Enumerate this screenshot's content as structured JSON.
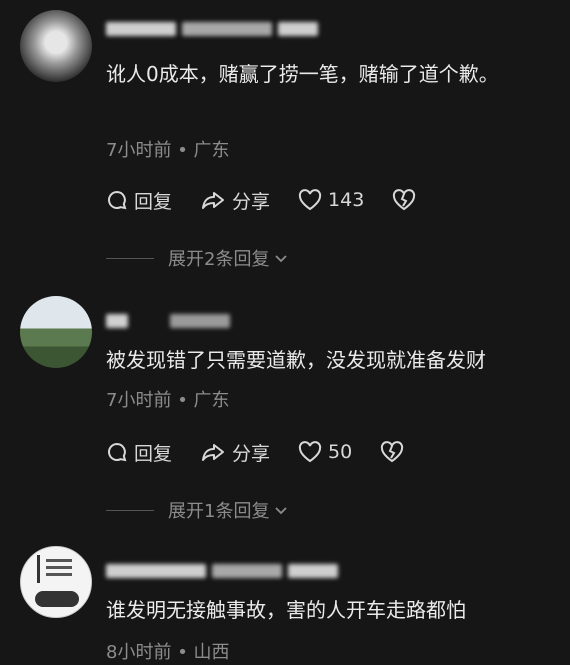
{
  "comments": [
    {
      "text": "讹人0成本，赌赢了捞一笔，赌输了道个歉。",
      "time": "7小时前",
      "region": "广东",
      "reply_label": "回复",
      "share_label": "分享",
      "likes": "143",
      "expand": "展开2条回复"
    },
    {
      "text": "被发现错了只需要道歉，没发现就准备发财",
      "time": "7小时前",
      "region": "广东",
      "reply_label": "回复",
      "share_label": "分享",
      "likes": "50",
      "expand": "展开1条回复"
    },
    {
      "text": "谁发明无接触事故，害的人开车走路都怕",
      "time": "8小时前",
      "region": "山西"
    }
  ],
  "separator": "•",
  "icons": [
    "comment-icon",
    "share-icon",
    "heart-icon",
    "broken-heart-icon",
    "chevron-down-icon"
  ],
  "colors": {
    "background": "#161616",
    "text": "#eaeaea",
    "muted": "#8c8c8c"
  }
}
